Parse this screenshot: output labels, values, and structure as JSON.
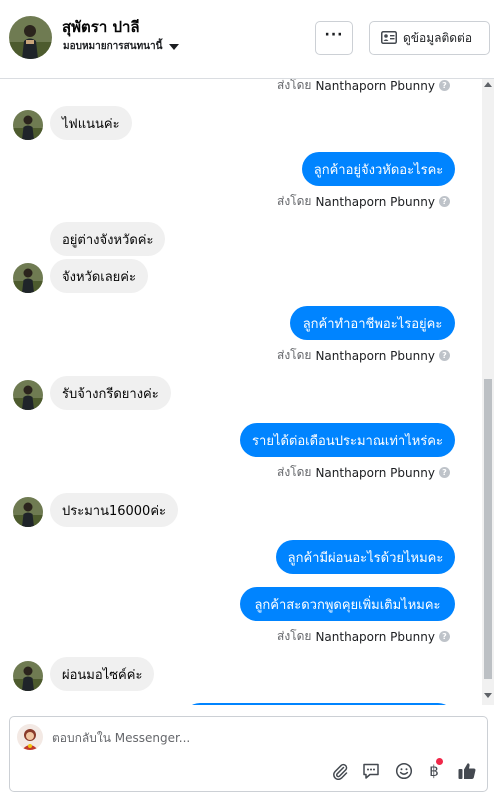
{
  "header": {
    "contact_name": "สุพัตรา ปาลี",
    "assign_label": "มอบหมายการสนทนานี้",
    "more_label": "···",
    "view_contact_label": "ดูข้อมูลติดต่อ"
  },
  "sender_prefix": "ส่งโดย",
  "sender_name": "Nanthaporn Pbunny",
  "help_glyph": "?",
  "messages": [
    {
      "from": "customer",
      "text": "ไฟแนนค่ะ"
    },
    {
      "from": "page",
      "text": "ลูกค้าอยู่จังวหัดอะไรคะ"
    },
    {
      "from": "customer",
      "text": "อยู่ต่างจังหวัดค่ะ"
    },
    {
      "from": "customer",
      "text": "จังหวัดเลยค่ะ"
    },
    {
      "from": "page",
      "text": "ลูกค้าทำอาชีพอะไรอยู่คะ"
    },
    {
      "from": "customer",
      "text": "รับจ้างกรีดยางค่ะ"
    },
    {
      "from": "page",
      "text": "รายได้ต่อเดือนประมาณเท่าไหร่คะ"
    },
    {
      "from": "customer",
      "text": "ประมาน16000ค่ะ"
    },
    {
      "from": "page",
      "text": "ลูกค้ามีผ่อนอะไรด้วยไหมคะ"
    },
    {
      "from": "page",
      "text": "ลูกค้าสะดวกพูดคุยเพิ่มเติมไหมคะ"
    },
    {
      "from": "customer",
      "text": "ผ่อนมอไซค์ค่ะ"
    }
  ],
  "composer": {
    "placeholder": "ตอบกลับใน Messenger...",
    "baht_glyph": "฿"
  },
  "colors": {
    "outgoing_bubble": "#0084ff",
    "incoming_bubble": "#f0f0f0",
    "notification_dot": "#f02849"
  },
  "icons": [
    "more-icon",
    "contact-card-icon",
    "attach-icon",
    "saved-reply-icon",
    "emoji-icon",
    "baht-icon",
    "like-icon",
    "help-icon"
  ]
}
